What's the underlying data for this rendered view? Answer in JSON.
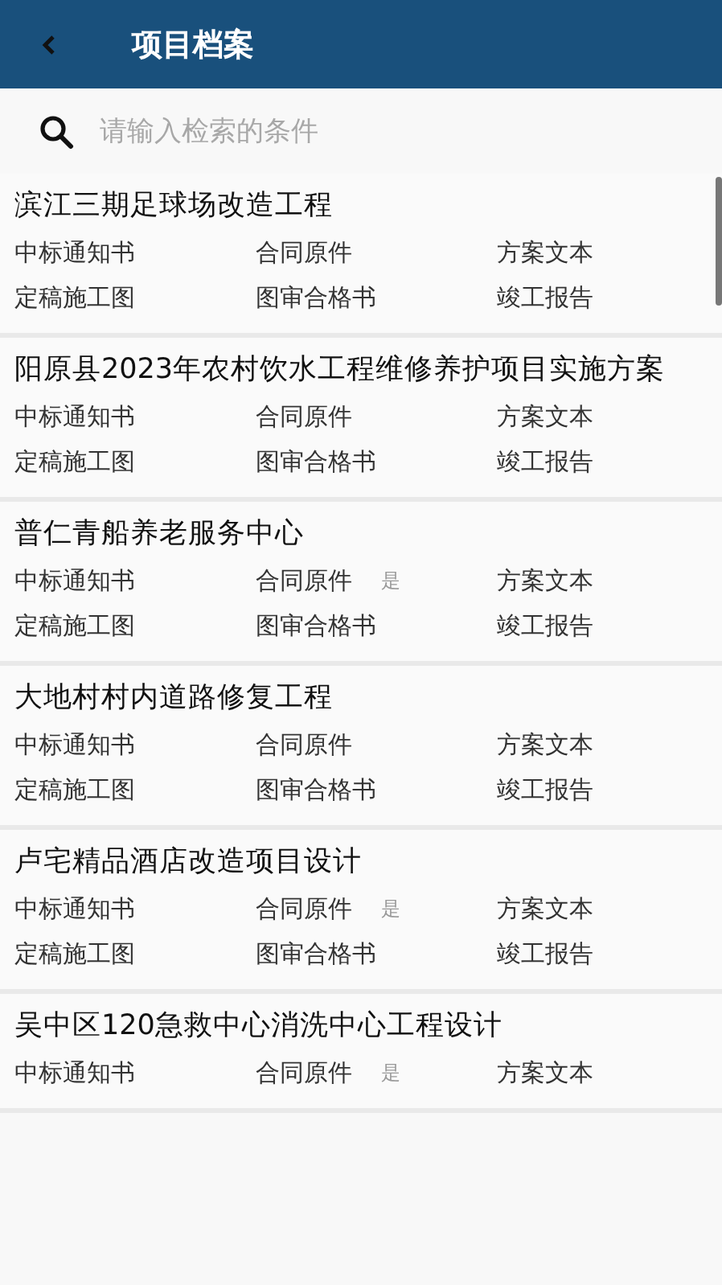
{
  "header": {
    "title": "项目档案"
  },
  "search": {
    "placeholder": "请输入检索的条件"
  },
  "projects": [
    {
      "title": "滨江三期足球场改造工程",
      "docs": [
        [
          {
            "label": "中标通知书"
          },
          {
            "label": "合同原件"
          },
          {
            "label": "方案文本"
          }
        ],
        [
          {
            "label": "定稿施工图"
          },
          {
            "label": "图审合格书"
          },
          {
            "label": "竣工报告"
          }
        ]
      ]
    },
    {
      "title": "阳原县2023年农村饮水工程维修养护项目实施方案",
      "docs": [
        [
          {
            "label": "中标通知书"
          },
          {
            "label": "合同原件"
          },
          {
            "label": "方案文本"
          }
        ],
        [
          {
            "label": "定稿施工图"
          },
          {
            "label": "图审合格书"
          },
          {
            "label": "竣工报告"
          }
        ]
      ]
    },
    {
      "title": "普仁青船养老服务中心",
      "docs": [
        [
          {
            "label": "中标通知书"
          },
          {
            "label": "合同原件",
            "note": "是"
          },
          {
            "label": "方案文本"
          }
        ],
        [
          {
            "label": "定稿施工图"
          },
          {
            "label": "图审合格书"
          },
          {
            "label": "竣工报告"
          }
        ]
      ]
    },
    {
      "title": "大地村村内道路修复工程",
      "docs": [
        [
          {
            "label": "中标通知书"
          },
          {
            "label": "合同原件"
          },
          {
            "label": "方案文本"
          }
        ],
        [
          {
            "label": "定稿施工图"
          },
          {
            "label": "图审合格书"
          },
          {
            "label": "竣工报告"
          }
        ]
      ]
    },
    {
      "title": "卢宅精品酒店改造项目设计",
      "docs": [
        [
          {
            "label": "中标通知书"
          },
          {
            "label": "合同原件",
            "note": "是"
          },
          {
            "label": "方案文本"
          }
        ],
        [
          {
            "label": "定稿施工图"
          },
          {
            "label": "图审合格书"
          },
          {
            "label": "竣工报告"
          }
        ]
      ]
    },
    {
      "title": "吴中区120急救中心消洗中心工程设计",
      "docs": [
        [
          {
            "label": "中标通知书"
          },
          {
            "label": "合同原件",
            "note": "是"
          },
          {
            "label": "方案文本"
          }
        ]
      ]
    }
  ]
}
